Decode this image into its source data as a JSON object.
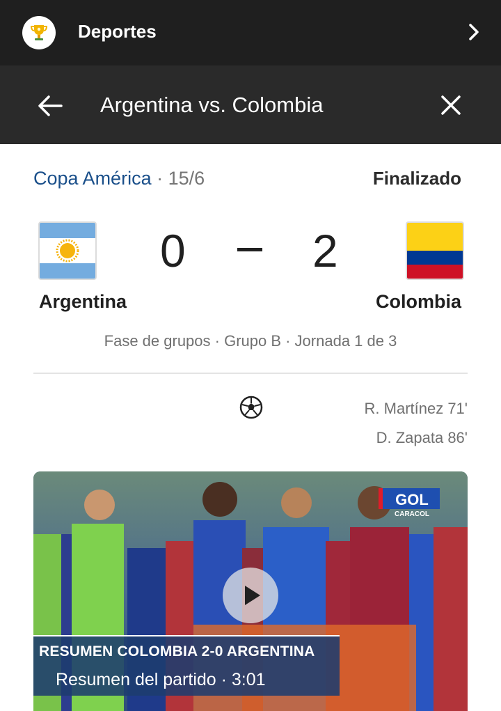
{
  "topbar": {
    "title": "Deportes",
    "icon": "trophy-icon"
  },
  "search": {
    "query": "Argentina vs. Colombia"
  },
  "match": {
    "competition": "Copa América",
    "separator": "·",
    "date": "15/6",
    "status": "Finalizado",
    "home": {
      "name": "Argentina",
      "score": "0"
    },
    "away": {
      "name": "Colombia",
      "score": "2"
    },
    "stage": "Fase de grupos · Grupo B · Jornada 1 de 3",
    "scorers": [
      "R. Martínez 71'",
      "D. Zapata 86'"
    ]
  },
  "video": {
    "badge_main": "GOL",
    "badge_sub": "CARACOL",
    "title": "RESUMEN COLOMBIA 2-0 ARGENTINA",
    "subtitle": "Resumen del partido  ·  3:01"
  },
  "colors": {
    "topbar_bg": "#1f1f1f",
    "searchbar_bg": "#2a2a2a",
    "competition_link": "#1a4f8a",
    "argentina_blue": "#74acdf",
    "colombia_yellow": "#fcd116",
    "colombia_blue": "#003893",
    "colombia_red": "#ce1126"
  }
}
